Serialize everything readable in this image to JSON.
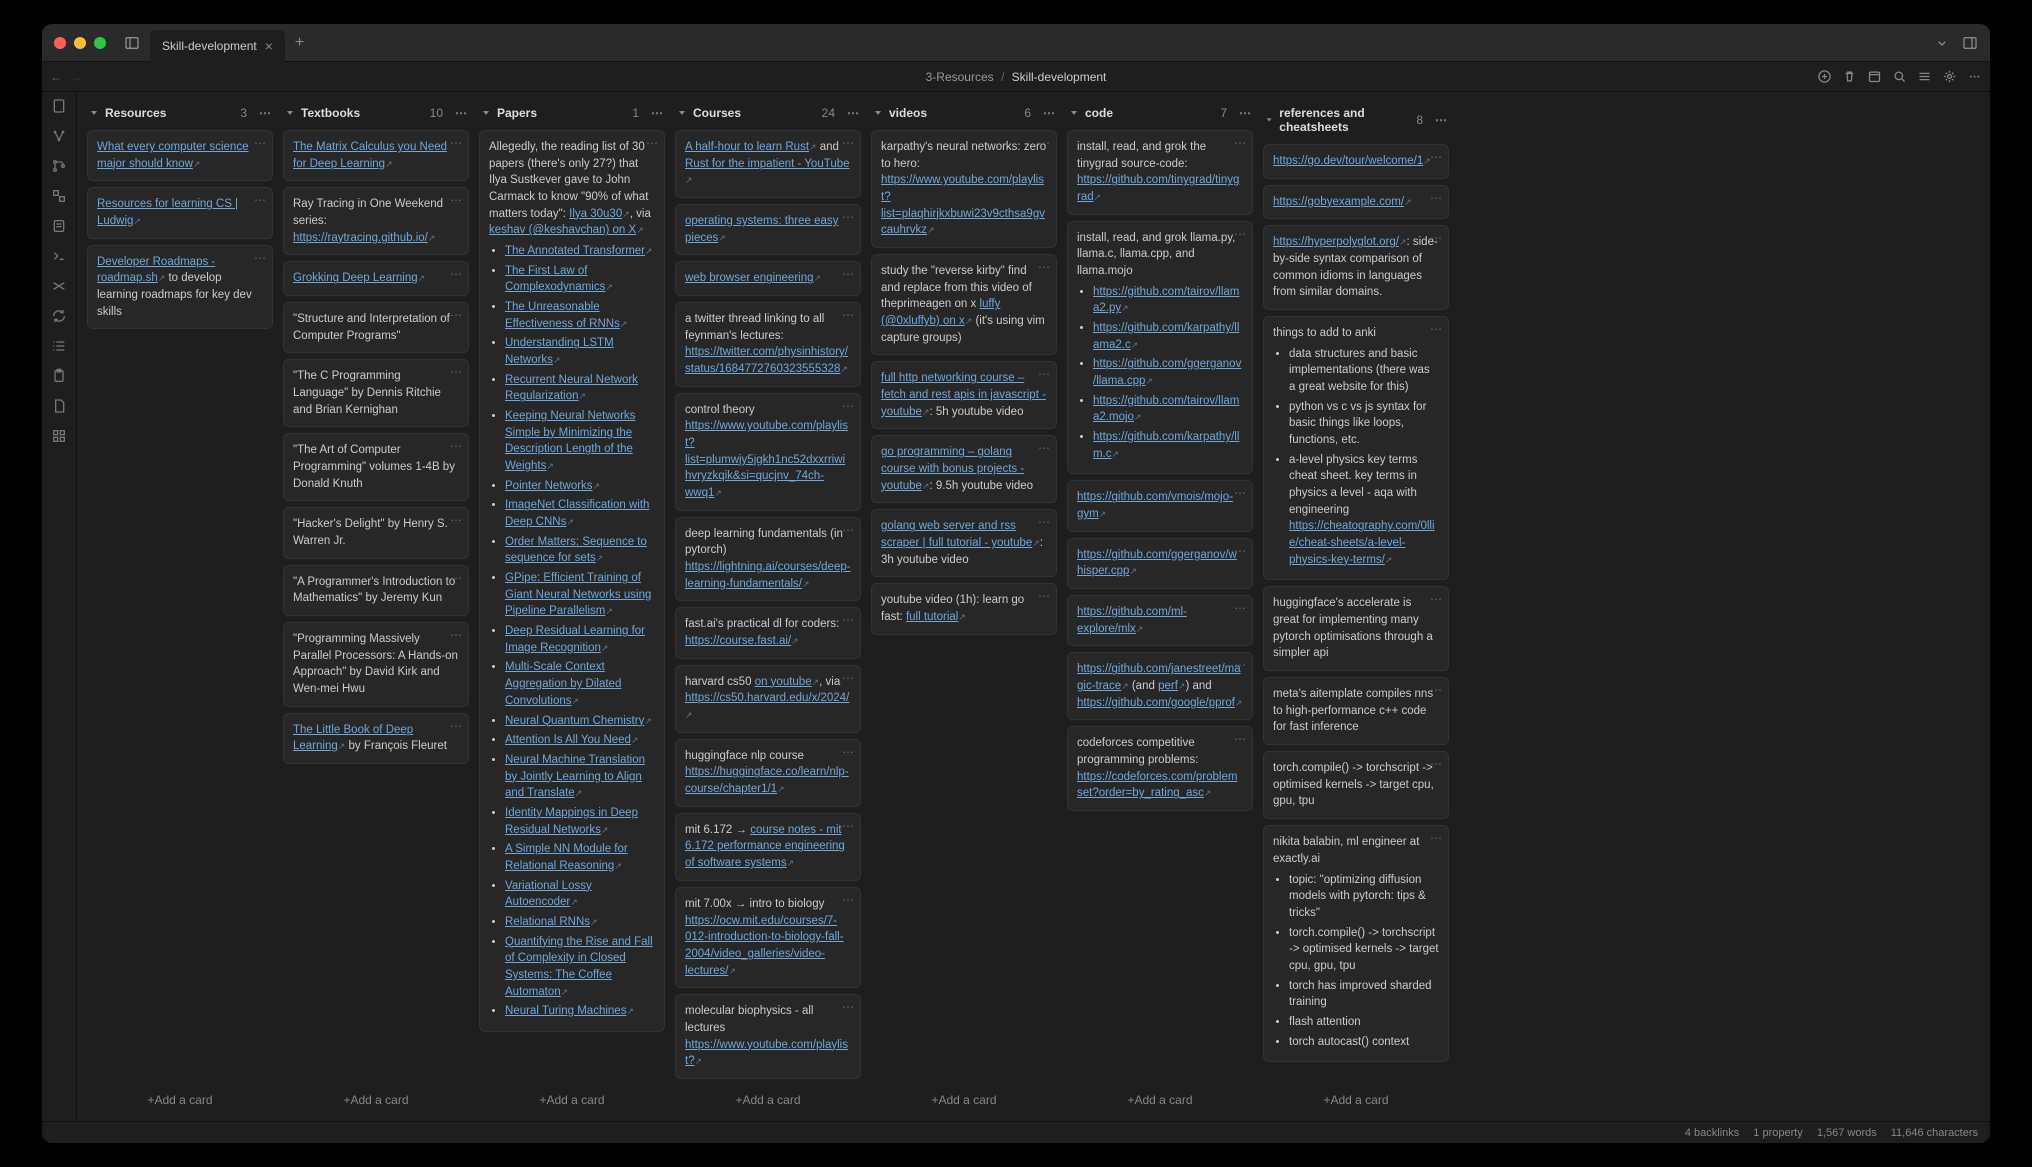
{
  "window": {
    "tab_title": "Skill-development"
  },
  "breadcrumb": {
    "parent": "3-Resources",
    "current": "Skill-development"
  },
  "add_card_label": "Add a card",
  "columns": [
    {
      "title": "Resources",
      "count": "3",
      "cards": [
        {
          "html": "<a class='lk ext'>What every computer science major should know</a>"
        },
        {
          "html": "<a class='lk ext'>Resources for learning CS | Ludwig</a>"
        },
        {
          "html": "<a class='lk ext'>Developer Roadmaps - roadmap.sh</a> to develop learning roadmaps for key dev skills"
        }
      ]
    },
    {
      "title": "Textbooks",
      "count": "10",
      "cards": [
        {
          "html": "<a class='lk ext'>The Matrix Calculus you Need for Deep Learning</a>"
        },
        {
          "html": "Ray Tracing in One Weekend series: <a class='lk ext'>https://raytracing.github.io/</a>"
        },
        {
          "html": "<a class='lk ext'>Grokking Deep Learning</a>"
        },
        {
          "html": "\"Structure and Interpretation of Computer Programs\""
        },
        {
          "html": "\"The C Programming Language\" by Dennis Ritchie and Brian Kernighan"
        },
        {
          "html": "\"The Art of Computer Programming\" volumes 1-4B by Donald Knuth"
        },
        {
          "html": "\"Hacker's Delight\" by Henry S. Warren Jr."
        },
        {
          "html": "\"A Programmer's Introduction to Mathematics\" by Jeremy Kun"
        },
        {
          "html": "\"Programming Massively Parallel Processors: A Hands-on Approach\" by David Kirk and Wen-mei Hwu"
        },
        {
          "html": "<a class='lk ext'>The Little Book of Deep Learning</a> by François Fleuret"
        }
      ]
    },
    {
      "title": "Papers",
      "count": "1",
      "cards": [
        {
          "html": "Allegedly, the reading list of 30 papers (there's only 27?) that Ilya Sustkever gave to John Carmack to know \"90% of what matters today\": <a class='lk ext'>Ilya 30u30</a>, via <a class='lk ext'>keshav (@keshavchan) on X</a><ul><li><a class='lk ext'>The Annotated Transformer</a></li><li><a class='lk ext'>The First Law of Complexodynamics</a></li><li><a class='lk ext'>The Unreasonable Effectiveness of RNNs</a></li><li><a class='lk ext'>Understanding LSTM Networks</a></li><li><a class='lk ext'>Recurrent Neural Network Regularization</a></li><li><a class='lk ext'>Keeping Neural Networks Simple by Minimizing the Description Length of the Weights</a></li><li><a class='lk ext'>Pointer Networks</a></li><li><a class='lk ext'>ImageNet Classification with Deep CNNs</a></li><li><a class='lk ext'>Order Matters: Sequence to sequence for sets</a></li><li><a class='lk ext'>GPipe: Efficient Training of Giant Neural Networks using Pipeline Parallelism</a></li><li><a class='lk ext'>Deep Residual Learning for Image Recognition</a></li><li><a class='lk ext'>Multi-Scale Context Aggregation by Dilated Convolutions</a></li><li><a class='lk ext'>Neural Quantum Chemistry</a></li><li><a class='lk ext'>Attention Is All You Need</a></li><li><a class='lk ext'>Neural Machine Translation by Jointly Learning to Align and Translate</a></li><li><a class='lk ext'>Identity Mappings in Deep Residual Networks</a></li><li><a class='lk ext'>A Simple NN Module for Relational Reasoning</a></li><li><a class='lk ext'>Variational Lossy Autoencoder</a></li><li><a class='lk ext'>Relational RNNs</a></li><li><a class='lk ext'>Quantifying the Rise and Fall of Complexity in Closed Systems: The Coffee Automaton</a></li><li><a class='lk ext'>Neural Turing Machines</a></li></ul>"
        }
      ]
    },
    {
      "title": "Courses",
      "count": "24",
      "cards": [
        {
          "html": "<a class='lk ext'>A half-hour to learn Rust</a> and <a class='lk ext'>Rust for the impatient - YouTube</a>"
        },
        {
          "html": "<a class='lk ext'>operating systems: three easy pieces</a>"
        },
        {
          "html": "<a class='lk ext'>web browser engineering</a>"
        },
        {
          "html": "a twitter thread linking to all feynman's lectures: <a class='lk ext'>https://twitter.com/physinhistory/status/1684772760323555328</a>"
        },
        {
          "html": "control theory <a class='lk ext'>https://www.youtube.com/playlist?list=plumwjy5jgkh1nc52dxxrriwihvryzkqik&si=qucjnv_74ch-wwq1</a>"
        },
        {
          "html": "deep learning fundamentals (in pytorch) <a class='lk ext'>https://lightning.ai/courses/deep-learning-fundamentals/</a>"
        },
        {
          "html": "fast.ai's practical dl for coders: <a class='lk ext'>https://course.fast.ai/</a>"
        },
        {
          "html": "harvard cs50 <a class='lk ext'>on youtube</a>, via <a class='lk ext'>https://cs50.harvard.edu/x/2024/</a>"
        },
        {
          "html": "huggingface nlp course <a class='lk ext'>https://huggingface.co/learn/nlp-course/chapter1/1</a>"
        },
        {
          "html": "mit 6.172 → <a class='lk ext'>course notes - mit 6.172 performance engineering of software systems</a>"
        },
        {
          "html": "mit 7.00x → intro to biology <a class='lk ext'>https://ocw.mit.edu/courses/7-012-introduction-to-biology-fall-2004/video_galleries/video-lectures/</a>"
        },
        {
          "html": "molecular biophysics - all lectures <a class='lk ext'>https://www.youtube.com/playlist?</a>"
        }
      ]
    },
    {
      "title": "videos",
      "count": "6",
      "cards": [
        {
          "html": "karpathy's neural networks: zero to hero: <a class='lk ext'>https://www.youtube.com/playlist?list=plaqhirjkxbuwi23v9cthsa9gvcauhrvkz</a>"
        },
        {
          "html": "study the \"reverse kirby\" find and replace from this video of theprimeagen on x <a class='lk ext'>luffy (@0xluffyb) on x</a> (it's using vim capture groups)"
        },
        {
          "html": "<a class='lk ext'>full http networking course – fetch and rest apis in javascript - youtube</a>: 5h youtube video"
        },
        {
          "html": "<a class='lk ext'>go programming – golang course with bonus projects - youtube</a>: 9.5h youtube video"
        },
        {
          "html": "<a class='lk ext'>golang web server and rss scraper | full tutorial - youtube</a>: 3h youtube video"
        },
        {
          "html": "youtube video (1h): learn go fast: <a class='lk ext'>full tutorial</a>"
        }
      ]
    },
    {
      "title": "code",
      "count": "7",
      "cards": [
        {
          "html": "install, read, and grok the tinygrad source-code: <a class='lk ext'>https://github.com/tinygrad/tinygrad</a>"
        },
        {
          "html": "install, read, and grok llama.py, llama.c, llama.cpp, and llama.mojo<ul><li><a class='lk ext'>https://github.com/tairov/llama2.py</a></li><li><a class='lk ext'>https://github.com/karpathy/llama2.c</a></li><li><a class='lk ext'>https://github.com/ggerganov/llama.cpp</a></li><li><a class='lk ext'>https://github.com/tairov/llama2.mojo</a></li><li><a class='lk ext'>https://github.com/karpathy/llm.c</a></li></ul>"
        },
        {
          "html": "<a class='lk ext'>https://github.com/vmois/mojo-gym</a>"
        },
        {
          "html": "<a class='lk ext'>https://github.com/ggerganov/whisper.cpp</a>"
        },
        {
          "html": "<a class='lk ext'>https://github.com/ml-explore/mlx</a>"
        },
        {
          "html": "<a class='lk ext'>https://github.com/janestreet/magic-trace</a> (and <a class='lk ext'>perf</a>) and <a class='lk ext'>https://github.com/google/pprof</a>"
        },
        {
          "html": "codeforces competitive programming problems: <a class='lk ext'>https://codeforces.com/problemset?order=by_rating_asc</a>"
        }
      ]
    },
    {
      "title": "references and cheatsheets",
      "count": "8",
      "cards": [
        {
          "html": "<a class='lk ext'>https://go.dev/tour/welcome/1</a>"
        },
        {
          "html": "<a class='lk ext'>https://gobyexample.com/</a>"
        },
        {
          "html": "<a class='lk ext'>https://hyperpolyglot.org/</a>: side-by-side syntax comparison of common idioms in languages from similar domains."
        },
        {
          "html": "things to add to anki<ul><li>data structures and basic implementations (there was a great website for this)</li><li>python vs c vs js syntax for basic things like loops, functions, etc.</li><li>a-level physics key terms cheat sheet. key terms in physics a level - aqa with engineering <a class='lk ext'>https://cheatography.com/0llie/cheat-sheets/a-level-physics-key-terms/</a></li></ul>"
        },
        {
          "html": "huggingface's accelerate is great for implementing many pytorch optimisations through a simpler api"
        },
        {
          "html": "meta's aitemplate compiles nns to high-performance c++ code for fast inference"
        },
        {
          "html": "torch.compile() -> torchscript -> optimised kernels -> target cpu, gpu, tpu"
        },
        {
          "html": "nikita balabin, ml engineer at exactly.ai<ul><li>topic: \"optimizing diffusion models with pytorch: tips &amp; tricks\"</li><li>torch.compile() -> torchscript -> optimised kernels -> target cpu, gpu, tpu</li><li>torch has improved sharded training</li><li>flash attention</li><li>torch autocast() context</li></ul>"
        }
      ]
    }
  ],
  "status": {
    "backlinks": "4 backlinks",
    "properties": "1 property",
    "words": "1,567 words",
    "chars": "11,646 characters"
  }
}
